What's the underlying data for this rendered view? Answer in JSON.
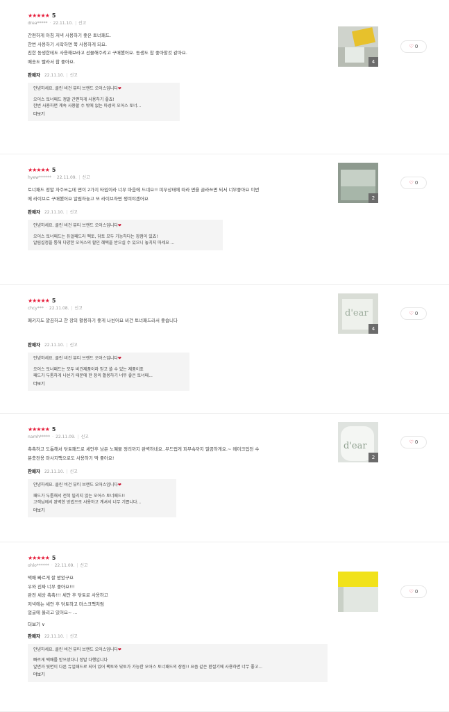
{
  "reviews": [
    {
      "stars": "★★★★★",
      "score": "5",
      "user": "drea*****",
      "date": "22.11.10.",
      "report": "신고",
      "body": [
        "간편하게 아침 저녁 사용하기 좋은 토너패드.",
        "한번 사용하기 시작하면 쭉 사용하게 되요.",
        "친한 동생한테도 사용해보라고 선물해주려고 구매했어요. 동생도 참 좋아할것 같아요.",
        "배송도 빨라서 참 좋아요."
      ],
      "more": "",
      "seller_label": "판매자",
      "seller_date": "22.11.10.",
      "seller_report": "신고",
      "reply": [
        "안녕하세요. 클린 비건 뷰티 브랜드 오어스입니다",
        "오어스 토너패드 정말 간편하게 사용하기 좋죠!",
        "한번 사용하면 계속 사용할 수 밖에 없는 마성의 오어스 토너..."
      ],
      "reply_more": "더보기",
      "photo_count": "4",
      "likes": "0"
    },
    {
      "stars": "★★★★★",
      "score": "5",
      "user": "hyew******",
      "date": "22.11.09.",
      "report": "신고",
      "body": [
        "토너패드 정말 자주쓰는데 면이 2가지 타입이라 너무 마음에 드네요!! 피부상태에 따라 면을 골라쓰면 되서 너무좋아요 이번",
        "에 라이브로 구매했어요 알림하놓고 또 라이브하면 쟁여야겠어요"
      ],
      "more": "",
      "seller_label": "판매자",
      "seller_date": "22.11.10.",
      "seller_report": "신고",
      "reply": [
        "안녕하세요. 클린 비건 뷰티 브랜드 오어스입니다",
        "오어스 토너패드는 듀얼패드라 펙토, 닦토 모두 가능하다는 장점이 있죠!",
        "알림설정을 통해 다양한 오어스의 할인 혜택을 받으실 수 있으니 놓치지 마세요 ..."
      ],
      "reply_more": "",
      "photo_count": "2",
      "likes": "0"
    },
    {
      "stars": "★★★★★",
      "score": "5",
      "user": "chcy***",
      "date": "22.11.08.",
      "report": "신고",
      "body": [
        "패키지도 깔끔하고 한 장의 활용하기 좋게 나뉜어요 비건 토너패드라서 좋습니다"
      ],
      "more": "",
      "seller_label": "판매자",
      "seller_date": "22.11.10.",
      "seller_report": "신고",
      "reply": [
        "안녕하세요. 클린 비건 뷰티 브랜드 오어스입니다",
        "오어스 토너패드는 모두 비건제품이라 믿고 쓸 수 있는 제품이죠",
        "패드가 두툼하게 나뉜기 때문에 한 장의 활용하기 너무 좋은 토너패..."
      ],
      "reply_more": "더보기",
      "photo_count": "4",
      "likes": "0"
    },
    {
      "stars": "★★★★★",
      "score": "5",
      "user": "namh*****",
      "date": "22.11.09.",
      "report": "신고",
      "body": [
        "촉촉하고 도톰해서 닦토패드로 세안후 남은 노폐물 정리까지 완벽하네요..부드럽게 피부속까지 말끔하게요.~ 메이크업전 수",
        "분충전용 마사지팩으로도 사용하기 딱 좋아요!"
      ],
      "more": "",
      "seller_label": "판매자",
      "seller_date": "22.11.10.",
      "seller_report": "신고",
      "reply": [
        "안녕하세요. 클린 비건 뷰티 브랜드 오어스입니다",
        "패드가 두툼해서 전혀 밀리지 않는 오어스 토너패드!!",
        "고객님께서 완벽한 방법으로 사용하고 계셔서 너무 기쁩니다..."
      ],
      "reply_more": "더보기",
      "photo_count": "2",
      "likes": "0"
    },
    {
      "stars": "★★★★★",
      "score": "5",
      "user": "ohlo******",
      "date": "22.11.09.",
      "report": "신고",
      "body": [
        "택배 빠르게 잘 받았구요",
        "우와 진짜 너무 좋아요!!!",
        "완전 세상 촉촉!!! 세안 후 닦토로 사용하고",
        "저녁에는 세안 후 닦토하고 마스크팩처럼",
        "얼굴에 올리고 있어요~ ..."
      ],
      "more": "더보기 ∨",
      "seller_label": "판매자",
      "seller_date": "22.11.10.",
      "seller_report": "신고",
      "reply": [
        "안녕하세요. 클린 비건 뷰티 브랜드 오어스입니다",
        "빠르게 택배를 받으셨다니 정말 다행입니다",
        "앞면과 뒷면이 다른 듀얼패드로 되어 있어 팩토와 닦토가 가능한 오어스 토너패드의 장점!! 요즘 같은 환절기에 사용하면 너무 좋고..."
      ],
      "reply_more": "더보기",
      "photo_count": "",
      "likes": "0"
    }
  ],
  "icons": {
    "like": "thumbs-up-icon",
    "heart": "heart-emoji-icon"
  },
  "colors": {
    "star": "#e51937",
    "reply_bg": "#f4f4f4"
  }
}
